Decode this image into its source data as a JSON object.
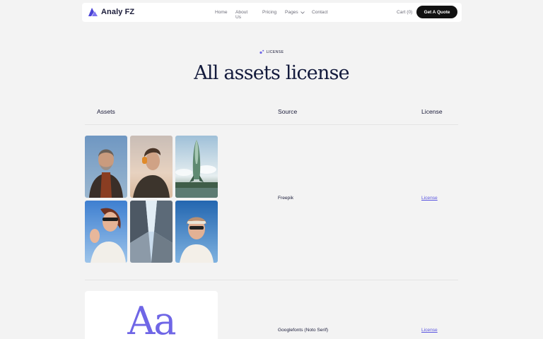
{
  "nav": {
    "brand": "Analy FZ",
    "links": [
      "Home",
      "About Us",
      "Pricing",
      "Pages",
      "Contact"
    ],
    "cart": "Cart (0)",
    "cta": "Get A Quote"
  },
  "hero": {
    "eyebrow": "LICENSE",
    "title": "All assets license"
  },
  "table": {
    "headers": [
      "Assets",
      "Source",
      "License"
    ],
    "rows": [
      {
        "source": "Freepik",
        "license": "License"
      },
      {
        "source": "Googlefonts (Noto Serif)",
        "license": "License",
        "sample": "Aa"
      }
    ]
  },
  "colors": {
    "accent": "#6f66e6",
    "brand_dark": "#131a3c",
    "button": "#111111"
  }
}
